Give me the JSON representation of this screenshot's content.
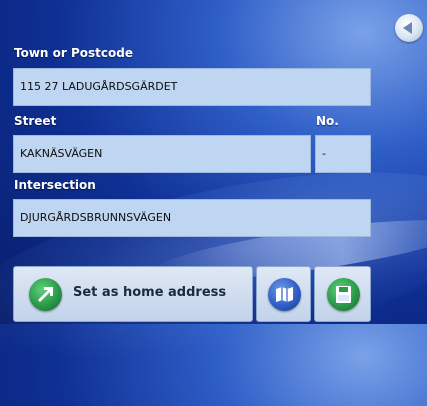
{
  "labels": {
    "town": "Town or Postcode",
    "street": "Street",
    "number": "No.",
    "intersection": "Intersection"
  },
  "fields": {
    "town": "115 27 LADUGÅRDSGÄRDET",
    "street": "KAKNÄSVÄGEN",
    "number": "-",
    "intersection": "DJURGÅRDSBRUNNSVÄGEN"
  },
  "buttons": {
    "home": "Set as home address",
    "map_icon": "map-icon",
    "save_icon": "save-icon",
    "back_icon": "back-arrow-icon"
  },
  "colors": {
    "field_bg": "#bfd6f2",
    "label_text": "#ffffff",
    "icon_green": "#2a9a4a"
  }
}
